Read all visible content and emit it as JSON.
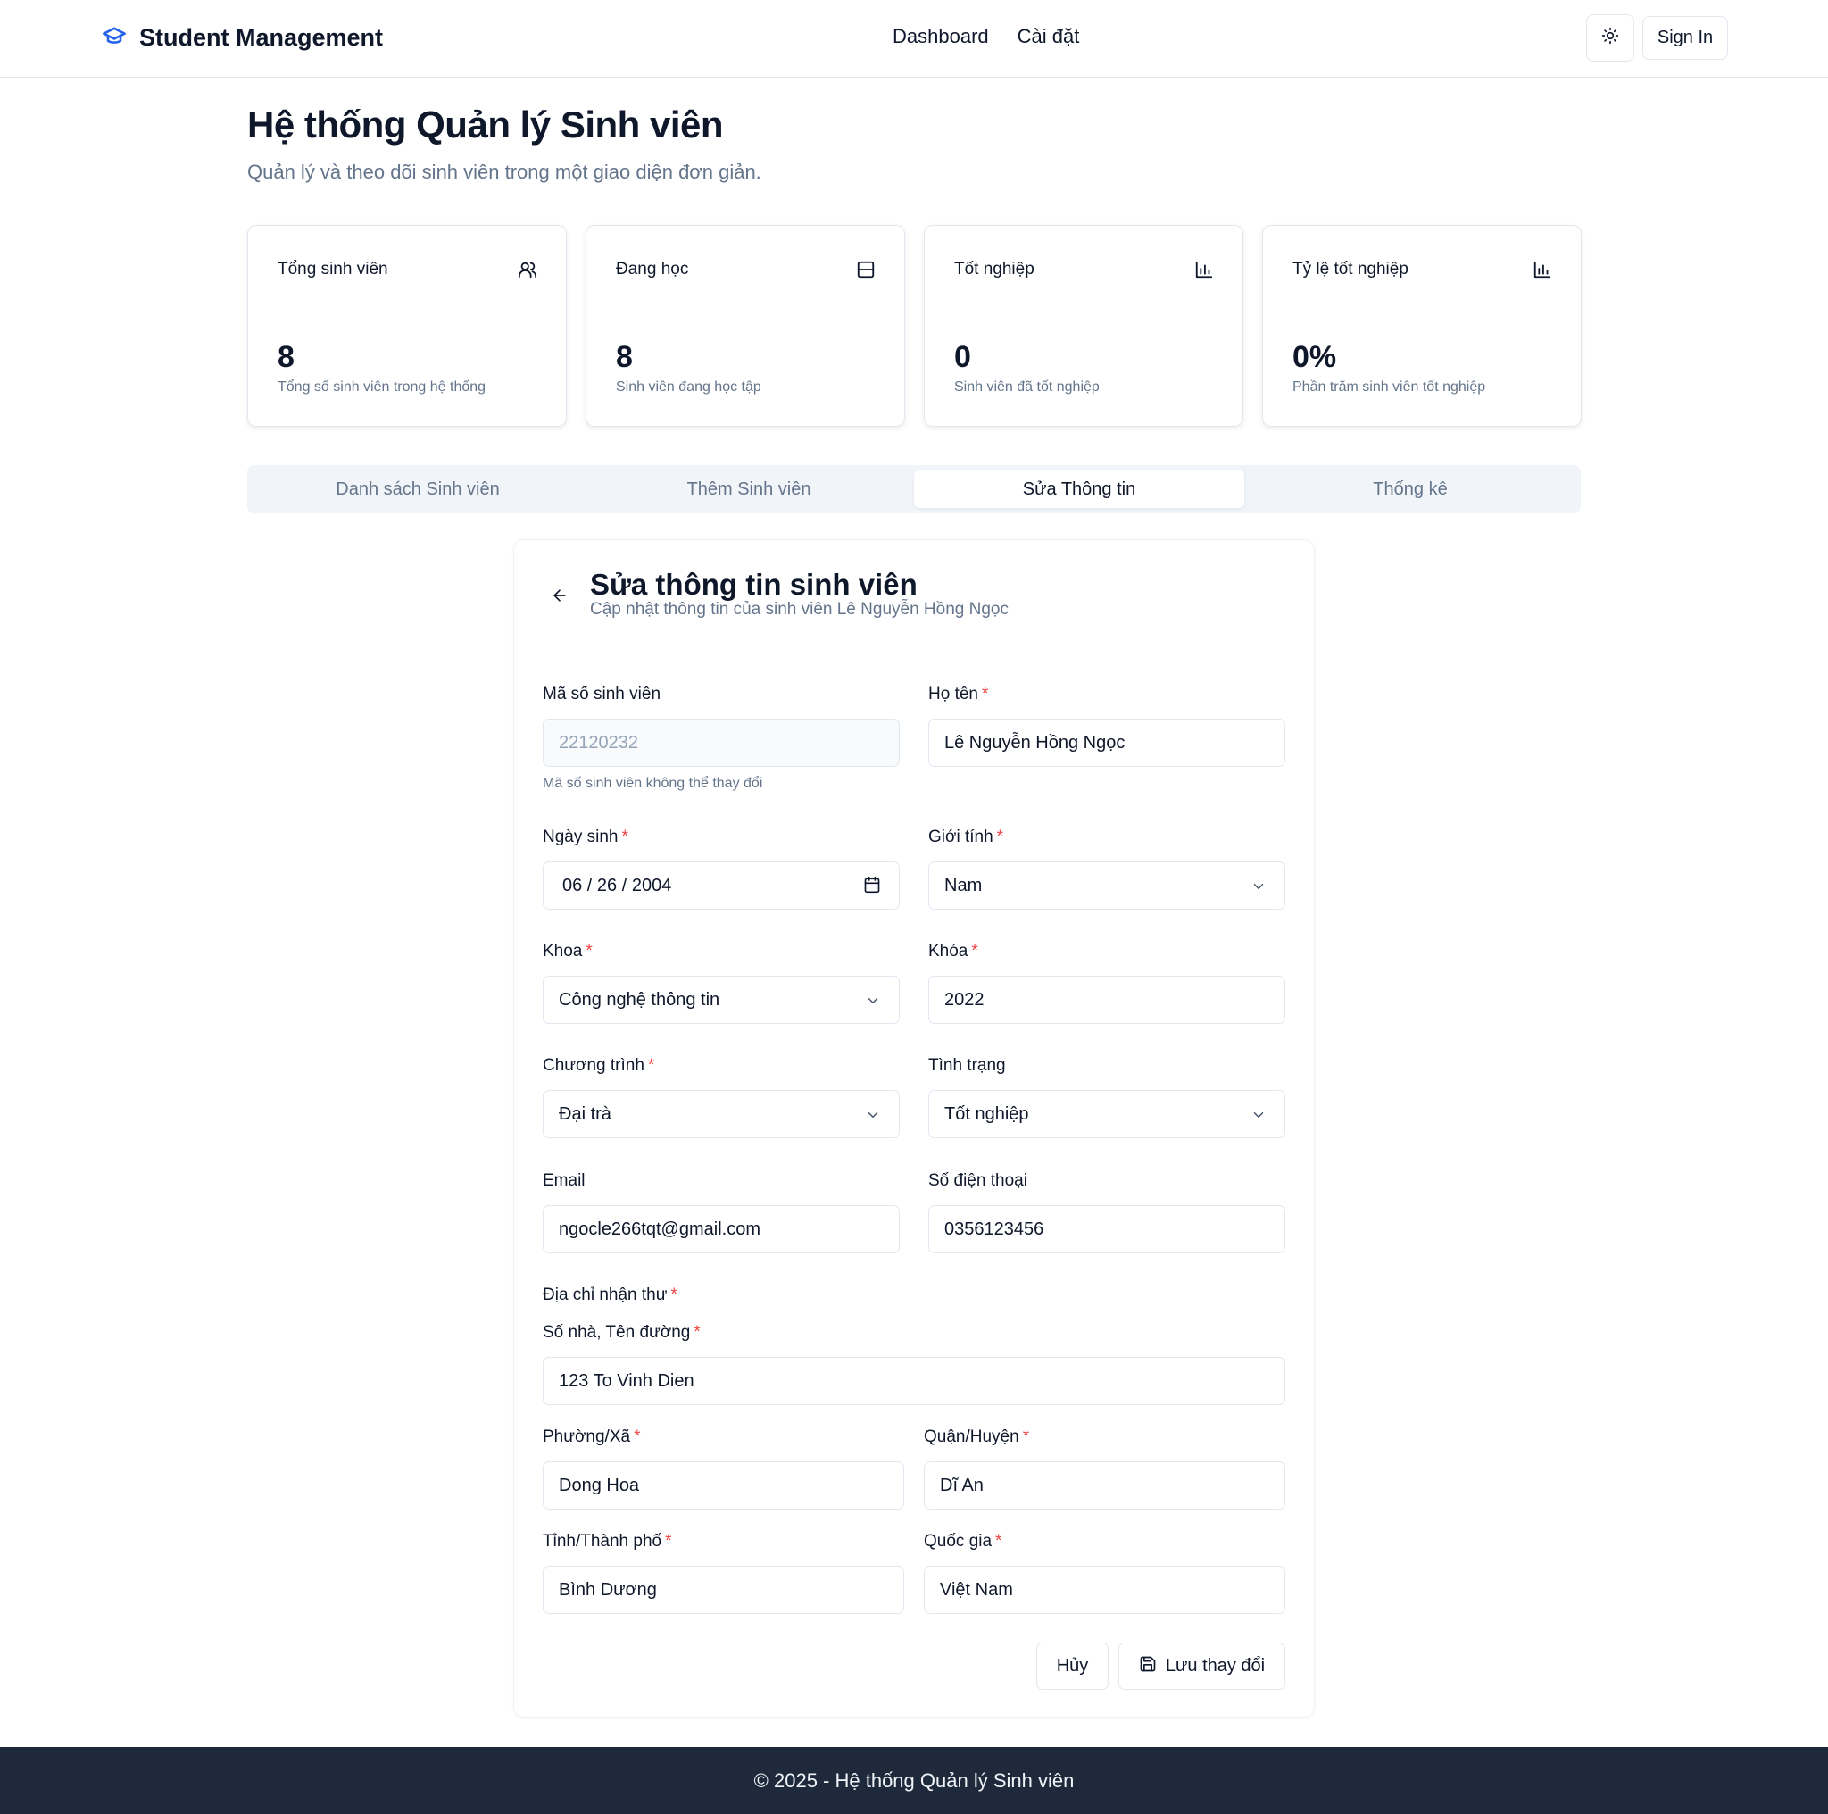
{
  "header": {
    "brand": "Student Management",
    "nav": [
      "Dashboard",
      "Cài đặt"
    ],
    "sign_in": "Sign In",
    "accent_color": "#2563eb"
  },
  "page": {
    "title": "Hệ thống Quản lý Sinh viên",
    "subtitle": "Quản lý và theo dõi sinh viên trong một giao diện đơn giản."
  },
  "stats": [
    {
      "title": "Tổng sinh viên",
      "value": "8",
      "desc": "Tổng số sinh viên trong hệ thống",
      "icon": "users-icon"
    },
    {
      "title": "Đang học",
      "value": "8",
      "desc": "Sinh viên đang học tập",
      "icon": "layout-icon"
    },
    {
      "title": "Tốt nghiệp",
      "value": "0",
      "desc": "Sinh viên đã tốt nghiệp",
      "icon": "bar-chart-icon"
    },
    {
      "title": "Tỷ lệ tốt nghiệp",
      "value": "0%",
      "desc": "Phần trăm sinh viên tốt nghiệp",
      "icon": "bar-chart-icon"
    }
  ],
  "tabs": [
    {
      "label": "Danh sách Sinh viên",
      "active": false
    },
    {
      "label": "Thêm Sinh viên",
      "active": false
    },
    {
      "label": "Sửa Thông tin",
      "active": true
    },
    {
      "label": "Thống kê",
      "active": false
    }
  ],
  "form": {
    "title": "Sửa thông tin sinh viên",
    "subtitle": "Cập nhật thông tin của sinh viên Lê Nguyễn Hồng Ngọc",
    "student_id": {
      "label": "Mã số sinh viên",
      "value": "22120232",
      "hint": "Mã số sinh viên không thể thay đổi"
    },
    "full_name": {
      "label": "Họ tên",
      "value": "Lê Nguyễn Hồng Ngọc"
    },
    "dob": {
      "label": "Ngày sinh",
      "value": "06 / 26 / 2004"
    },
    "gender": {
      "label": "Giới tính",
      "value": "Nam"
    },
    "faculty": {
      "label": "Khoa",
      "value": "Công nghệ thông tin"
    },
    "course": {
      "label": "Khóa",
      "value": "2022"
    },
    "program": {
      "label": "Chương trình",
      "value": "Đại trà"
    },
    "status": {
      "label": "Tình trạng",
      "value": "Tốt nghiệp"
    },
    "email": {
      "label": "Email",
      "value": "ngocle266tqt@gmail.com"
    },
    "phone": {
      "label": "Số điện thoại",
      "value": "0356123456"
    },
    "address_title": "Địa chỉ nhận thư",
    "street": {
      "label": "Số nhà, Tên đường",
      "value": "123 To Vinh Dien"
    },
    "ward": {
      "label": "Phường/Xã",
      "value": "Dong Hoa"
    },
    "district": {
      "label": "Quận/Huyện",
      "value": "Dĩ An"
    },
    "province": {
      "label": "Tỉnh/Thành phố",
      "value": "Bình Dương"
    },
    "country": {
      "label": "Quốc gia",
      "value": "Việt Nam"
    },
    "cancel": "Hủy",
    "save": "Lưu thay đổi"
  },
  "footer": {
    "text": "© 2025 - Hệ thống Quản lý Sinh viên"
  }
}
